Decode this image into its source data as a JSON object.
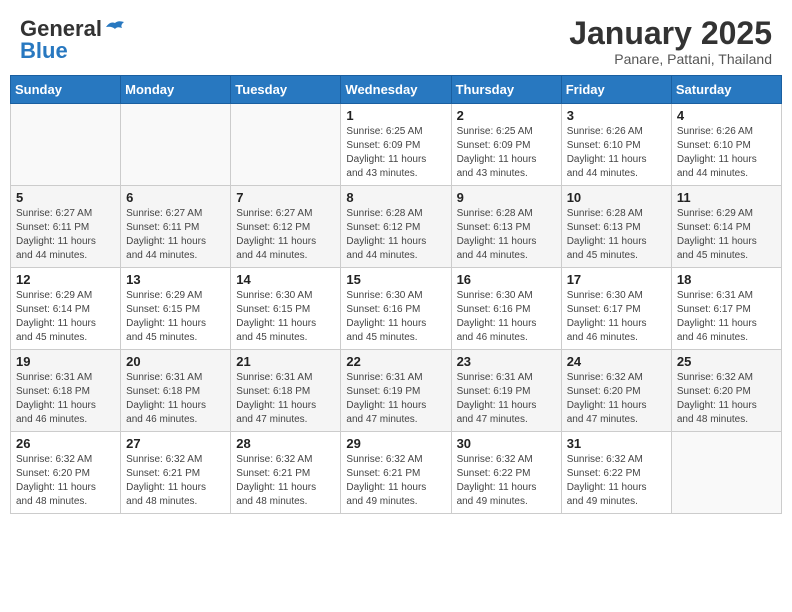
{
  "header": {
    "logo_general": "General",
    "logo_blue": "Blue",
    "title": "January 2025",
    "subtitle": "Panare, Pattani, Thailand"
  },
  "days_of_week": [
    "Sunday",
    "Monday",
    "Tuesday",
    "Wednesday",
    "Thursday",
    "Friday",
    "Saturday"
  ],
  "weeks": [
    [
      {
        "day": "",
        "info": ""
      },
      {
        "day": "",
        "info": ""
      },
      {
        "day": "",
        "info": ""
      },
      {
        "day": "1",
        "sunrise": "Sunrise: 6:25 AM",
        "sunset": "Sunset: 6:09 PM",
        "daylight": "Daylight: 11 hours and 43 minutes."
      },
      {
        "day": "2",
        "sunrise": "Sunrise: 6:25 AM",
        "sunset": "Sunset: 6:09 PM",
        "daylight": "Daylight: 11 hours and 43 minutes."
      },
      {
        "day": "3",
        "sunrise": "Sunrise: 6:26 AM",
        "sunset": "Sunset: 6:10 PM",
        "daylight": "Daylight: 11 hours and 44 minutes."
      },
      {
        "day": "4",
        "sunrise": "Sunrise: 6:26 AM",
        "sunset": "Sunset: 6:10 PM",
        "daylight": "Daylight: 11 hours and 44 minutes."
      }
    ],
    [
      {
        "day": "5",
        "sunrise": "Sunrise: 6:27 AM",
        "sunset": "Sunset: 6:11 PM",
        "daylight": "Daylight: 11 hours and 44 minutes."
      },
      {
        "day": "6",
        "sunrise": "Sunrise: 6:27 AM",
        "sunset": "Sunset: 6:11 PM",
        "daylight": "Daylight: 11 hours and 44 minutes."
      },
      {
        "day": "7",
        "sunrise": "Sunrise: 6:27 AM",
        "sunset": "Sunset: 6:12 PM",
        "daylight": "Daylight: 11 hours and 44 minutes."
      },
      {
        "day": "8",
        "sunrise": "Sunrise: 6:28 AM",
        "sunset": "Sunset: 6:12 PM",
        "daylight": "Daylight: 11 hours and 44 minutes."
      },
      {
        "day": "9",
        "sunrise": "Sunrise: 6:28 AM",
        "sunset": "Sunset: 6:13 PM",
        "daylight": "Daylight: 11 hours and 44 minutes."
      },
      {
        "day": "10",
        "sunrise": "Sunrise: 6:28 AM",
        "sunset": "Sunset: 6:13 PM",
        "daylight": "Daylight: 11 hours and 45 minutes."
      },
      {
        "day": "11",
        "sunrise": "Sunrise: 6:29 AM",
        "sunset": "Sunset: 6:14 PM",
        "daylight": "Daylight: 11 hours and 45 minutes."
      }
    ],
    [
      {
        "day": "12",
        "sunrise": "Sunrise: 6:29 AM",
        "sunset": "Sunset: 6:14 PM",
        "daylight": "Daylight: 11 hours and 45 minutes."
      },
      {
        "day": "13",
        "sunrise": "Sunrise: 6:29 AM",
        "sunset": "Sunset: 6:15 PM",
        "daylight": "Daylight: 11 hours and 45 minutes."
      },
      {
        "day": "14",
        "sunrise": "Sunrise: 6:30 AM",
        "sunset": "Sunset: 6:15 PM",
        "daylight": "Daylight: 11 hours and 45 minutes."
      },
      {
        "day": "15",
        "sunrise": "Sunrise: 6:30 AM",
        "sunset": "Sunset: 6:16 PM",
        "daylight": "Daylight: 11 hours and 45 minutes."
      },
      {
        "day": "16",
        "sunrise": "Sunrise: 6:30 AM",
        "sunset": "Sunset: 6:16 PM",
        "daylight": "Daylight: 11 hours and 46 minutes."
      },
      {
        "day": "17",
        "sunrise": "Sunrise: 6:30 AM",
        "sunset": "Sunset: 6:17 PM",
        "daylight": "Daylight: 11 hours and 46 minutes."
      },
      {
        "day": "18",
        "sunrise": "Sunrise: 6:31 AM",
        "sunset": "Sunset: 6:17 PM",
        "daylight": "Daylight: 11 hours and 46 minutes."
      }
    ],
    [
      {
        "day": "19",
        "sunrise": "Sunrise: 6:31 AM",
        "sunset": "Sunset: 6:18 PM",
        "daylight": "Daylight: 11 hours and 46 minutes."
      },
      {
        "day": "20",
        "sunrise": "Sunrise: 6:31 AM",
        "sunset": "Sunset: 6:18 PM",
        "daylight": "Daylight: 11 hours and 46 minutes."
      },
      {
        "day": "21",
        "sunrise": "Sunrise: 6:31 AM",
        "sunset": "Sunset: 6:18 PM",
        "daylight": "Daylight: 11 hours and 47 minutes."
      },
      {
        "day": "22",
        "sunrise": "Sunrise: 6:31 AM",
        "sunset": "Sunset: 6:19 PM",
        "daylight": "Daylight: 11 hours and 47 minutes."
      },
      {
        "day": "23",
        "sunrise": "Sunrise: 6:31 AM",
        "sunset": "Sunset: 6:19 PM",
        "daylight": "Daylight: 11 hours and 47 minutes."
      },
      {
        "day": "24",
        "sunrise": "Sunrise: 6:32 AM",
        "sunset": "Sunset: 6:20 PM",
        "daylight": "Daylight: 11 hours and 47 minutes."
      },
      {
        "day": "25",
        "sunrise": "Sunrise: 6:32 AM",
        "sunset": "Sunset: 6:20 PM",
        "daylight": "Daylight: 11 hours and 48 minutes."
      }
    ],
    [
      {
        "day": "26",
        "sunrise": "Sunrise: 6:32 AM",
        "sunset": "Sunset: 6:20 PM",
        "daylight": "Daylight: 11 hours and 48 minutes."
      },
      {
        "day": "27",
        "sunrise": "Sunrise: 6:32 AM",
        "sunset": "Sunset: 6:21 PM",
        "daylight": "Daylight: 11 hours and 48 minutes."
      },
      {
        "day": "28",
        "sunrise": "Sunrise: 6:32 AM",
        "sunset": "Sunset: 6:21 PM",
        "daylight": "Daylight: 11 hours and 48 minutes."
      },
      {
        "day": "29",
        "sunrise": "Sunrise: 6:32 AM",
        "sunset": "Sunset: 6:21 PM",
        "daylight": "Daylight: 11 hours and 49 minutes."
      },
      {
        "day": "30",
        "sunrise": "Sunrise: 6:32 AM",
        "sunset": "Sunset: 6:22 PM",
        "daylight": "Daylight: 11 hours and 49 minutes."
      },
      {
        "day": "31",
        "sunrise": "Sunrise: 6:32 AM",
        "sunset": "Sunset: 6:22 PM",
        "daylight": "Daylight: 11 hours and 49 minutes."
      },
      {
        "day": "",
        "info": ""
      }
    ]
  ]
}
